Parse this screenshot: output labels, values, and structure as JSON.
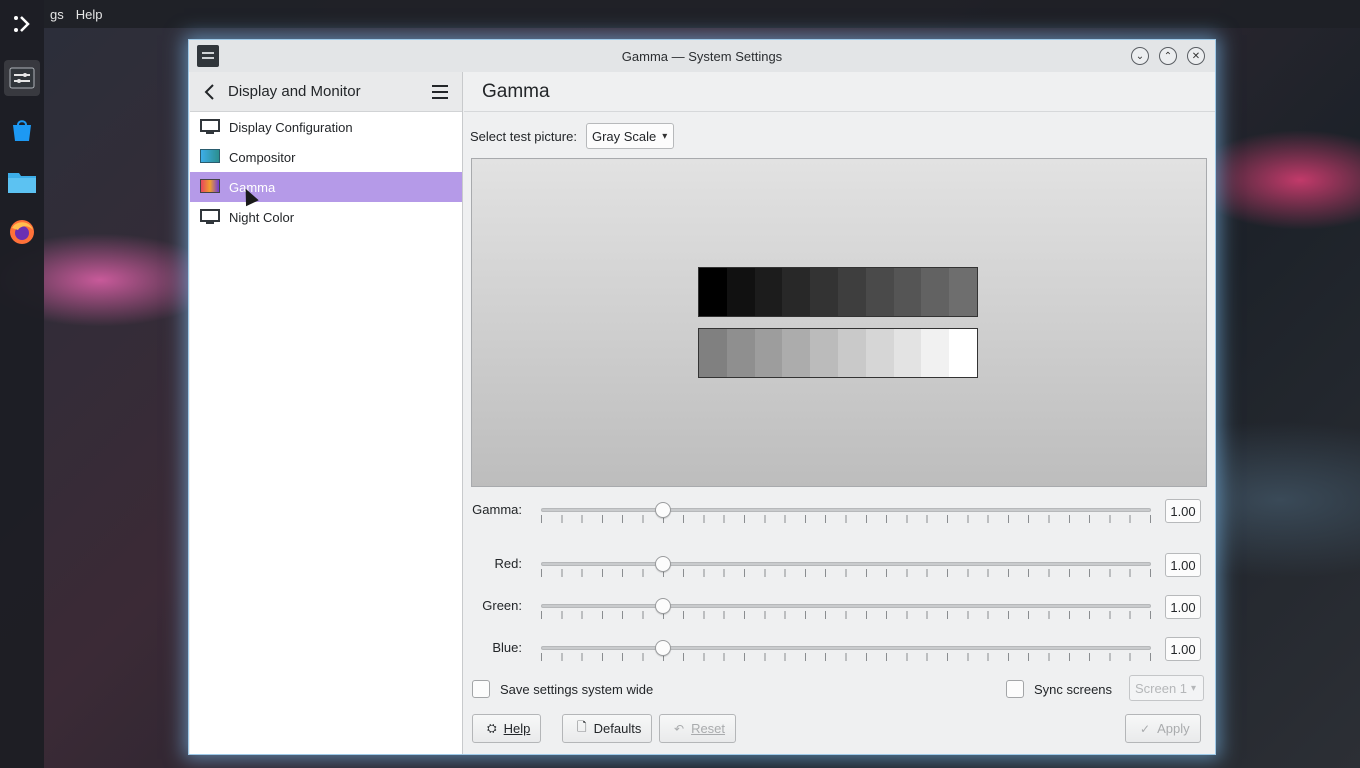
{
  "menubar": {
    "items": [
      "gs",
      "Help"
    ]
  },
  "dock": {
    "items": [
      "apps-launcher-icon",
      "system-settings-icon",
      "discover-store-icon",
      "file-manager-icon",
      "firefox-icon"
    ]
  },
  "window": {
    "title": "Gamma — System Settings",
    "buttons": {
      "minimize": "⌄",
      "maximize": "⌃",
      "close": "✕"
    }
  },
  "sidebar": {
    "title": "Display and Monitor",
    "items": [
      {
        "label": "Display Configuration",
        "icon": "monitor-icon"
      },
      {
        "label": "Compositor",
        "icon": "compositor-icon"
      },
      {
        "label": "Gamma",
        "icon": "gamma-icon",
        "selected": true
      },
      {
        "label": "Night Color",
        "icon": "monitor-icon"
      }
    ]
  },
  "main": {
    "title": "Gamma",
    "test_picture_label": "Select test picture:",
    "test_picture_value": "Gray Scale",
    "sliders": [
      {
        "label": "Gamma:",
        "value": "1.00",
        "fraction": 0.2
      },
      {
        "label": "Red:",
        "value": "1.00",
        "fraction": 0.2
      },
      {
        "label": "Green:",
        "value": "1.00",
        "fraction": 0.2
      },
      {
        "label": "Blue:",
        "value": "1.00",
        "fraction": 0.2
      }
    ],
    "save_system_wide_label": "Save settings system wide",
    "sync_screens_label": "Sync screens",
    "screen_select_value": "Screen 1",
    "buttons": {
      "help": "Help",
      "defaults": "Defaults",
      "reset": "Reset",
      "apply": "Apply"
    },
    "grayscale_top": [
      "#000000",
      "#111111",
      "#1c1c1c",
      "#282828",
      "#333333",
      "#3e3e3e",
      "#4a4a4a",
      "#555555",
      "#626262",
      "#6e6e6e"
    ],
    "grayscale_bottom": [
      "#808080",
      "#8f8f8f",
      "#9d9d9d",
      "#acacac",
      "#bbbbbb",
      "#c9c9c9",
      "#d6d6d6",
      "#e3e3e3",
      "#f1f1f1",
      "#ffffff"
    ]
  }
}
